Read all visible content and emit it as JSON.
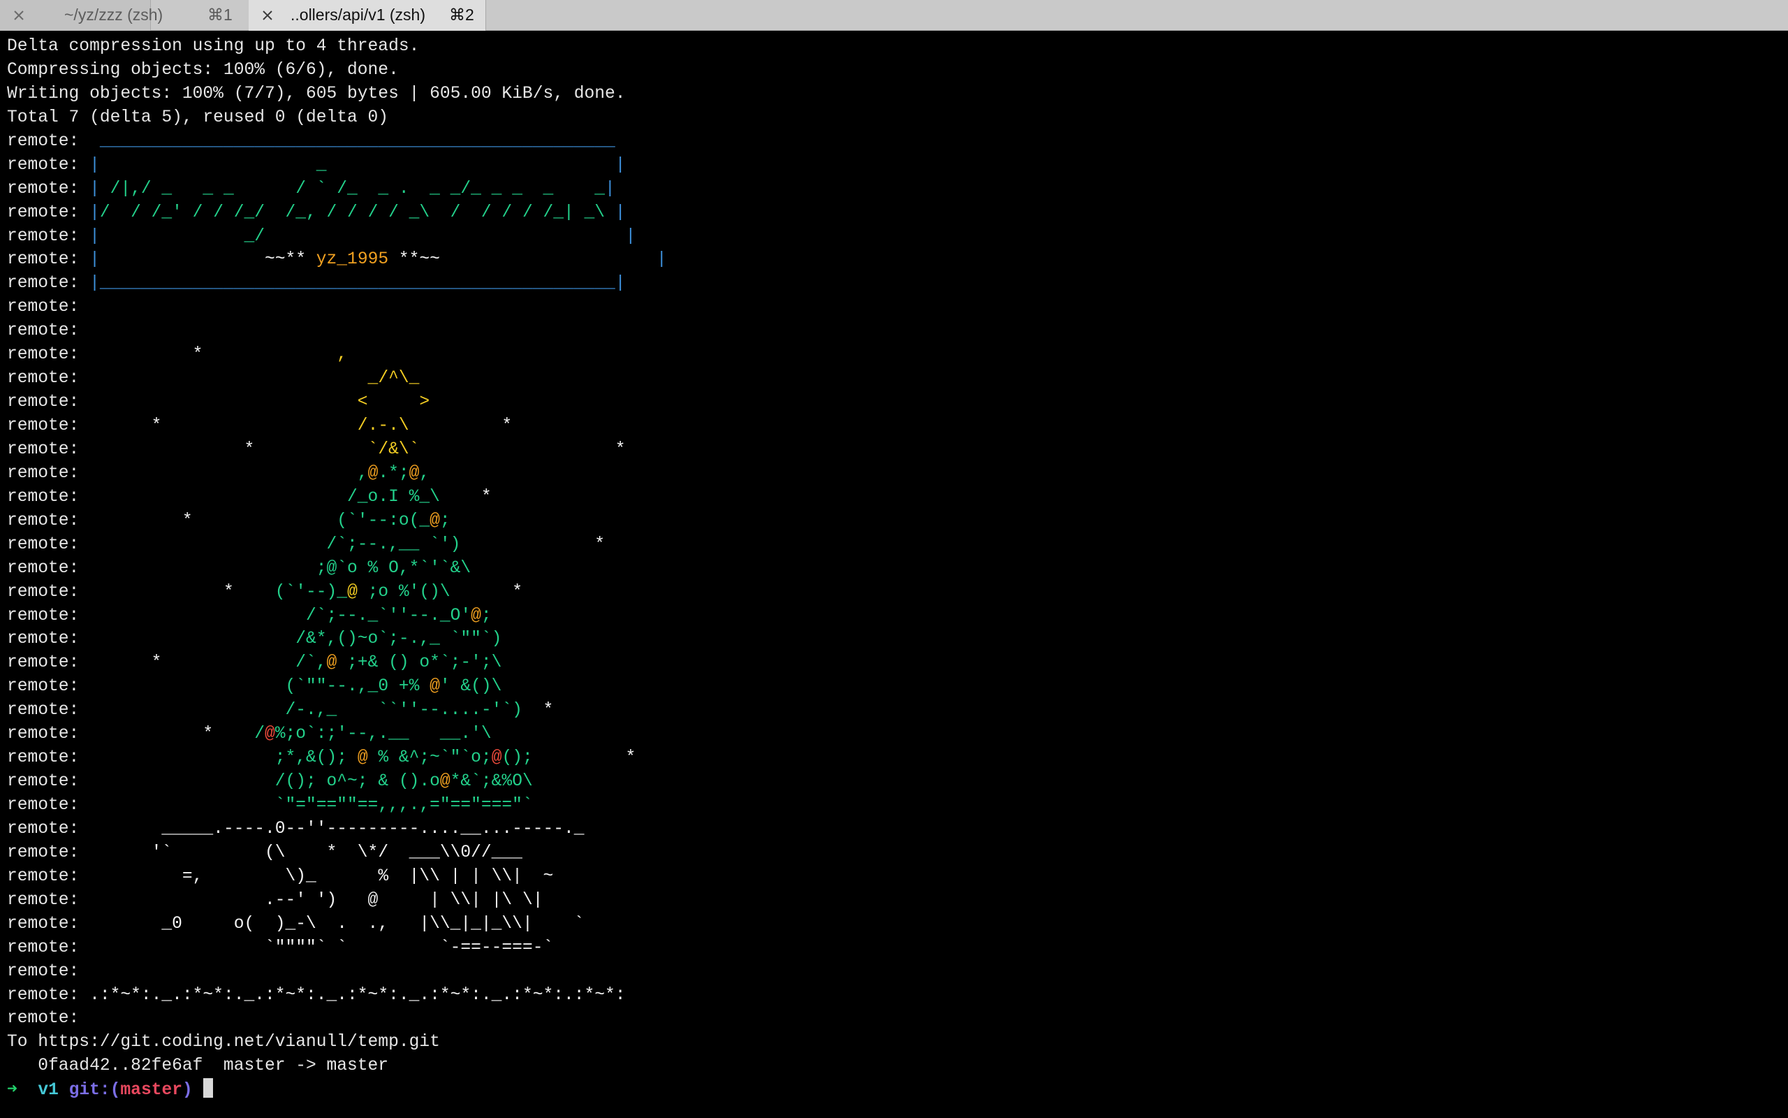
{
  "palette": {
    "default": "#e6e6e6",
    "blue": "#3d8fd9",
    "green": "#23d18b",
    "yellow": "#f3cd23",
    "orange": "#f0a020",
    "red": "#ef4b3c",
    "white": "#f2f2f2",
    "prompt_arrow": "#22d16b",
    "prompt_dir": "#45c8d6",
    "prompt_git": "#7b6ee6",
    "prompt_branch": "#e8485e"
  },
  "tabs": [
    {
      "title": "~/yz/zzz (zsh)",
      "shortcut": "⌘1",
      "close_icon": "close-icon",
      "active": false
    },
    {
      "title": "..ollers/api/v1 (zsh)",
      "shortcut": "⌘2",
      "close_icon": "close-icon",
      "active": true
    }
  ],
  "terminal": {
    "lines": [
      [
        [
          "Delta compression using up to 4 threads."
        ]
      ],
      [
        [
          "Compressing objects: 100% (6/6), done."
        ]
      ],
      [
        [
          "Writing objects: 100% (7/7), 605 bytes | 605.00 KiB/s, done."
        ]
      ],
      [
        [
          "Total 7 (delta 5), reused 0 (delta 0)"
        ]
      ],
      [
        [
          "remote: "
        ],
        [
          " __________________________________________________",
          "blue"
        ]
      ],
      [
        [
          "remote: "
        ],
        [
          "|",
          "blue"
        ],
        [
          "                     _                            ",
          "green"
        ],
        [
          "|",
          "blue"
        ]
      ],
      [
        [
          "remote: "
        ],
        [
          "|",
          "blue"
        ],
        [
          " /|,/ _   _ _      / ` /_  _ .  _ _/_ _ _  _    _",
          "green"
        ],
        [
          "|",
          "blue"
        ]
      ],
      [
        [
          "remote: "
        ],
        [
          "|",
          "blue"
        ],
        [
          "/  / /_' / / /_/  /_, / / / / _\\  /  / / / /_| _\\ ",
          "green"
        ],
        [
          "|",
          "blue"
        ]
      ],
      [
        [
          "remote: "
        ],
        [
          "|",
          "blue"
        ],
        [
          "              _/                                   ",
          "green"
        ],
        [
          "|",
          "blue"
        ]
      ],
      [
        [
          "remote: "
        ],
        [
          "|",
          "blue"
        ],
        [
          "                ~~** ",
          "white"
        ],
        [
          "yz_1995",
          "orange"
        ],
        [
          " **~~                     ",
          "white"
        ],
        [
          "|",
          "blue"
        ]
      ],
      [
        [
          "remote: "
        ],
        [
          "|__________________________________________________|",
          "blue"
        ]
      ],
      [
        [
          "remote: "
        ]
      ],
      [
        [
          "remote: "
        ]
      ],
      [
        [
          "remote: "
        ],
        [
          "          *",
          "white"
        ],
        [
          "             ,",
          "yellow"
        ]
      ],
      [
        [
          "remote: "
        ],
        [
          "                           _/^\\_",
          "yellow"
        ]
      ],
      [
        [
          "remote: "
        ],
        [
          "                          <     >",
          "yellow"
        ]
      ],
      [
        [
          "remote: "
        ],
        [
          "      *",
          "white"
        ],
        [
          "                   /.-.\\",
          "yellow"
        ],
        [
          "         *",
          "white"
        ]
      ],
      [
        [
          "remote: "
        ],
        [
          "               *",
          "white"
        ],
        [
          "           `/&\\`",
          "yellow"
        ],
        [
          "                   *",
          "white"
        ]
      ],
      [
        [
          "remote: "
        ],
        [
          "                          ,",
          "green"
        ],
        [
          "@",
          "orange"
        ],
        [
          ".*;",
          "green"
        ],
        [
          "@",
          "orange"
        ],
        [
          ",",
          "green"
        ]
      ],
      [
        [
          "remote: "
        ],
        [
          "                         /_o.I %_\\",
          "green"
        ],
        [
          "    *",
          "white"
        ]
      ],
      [
        [
          "remote: "
        ],
        [
          "         *",
          "white"
        ],
        [
          "              (`'--:o(_",
          "green"
        ],
        [
          "@",
          "orange"
        ],
        [
          ";",
          "green"
        ]
      ],
      [
        [
          "remote: "
        ],
        [
          "                       /`;--.,__ `')",
          "green"
        ],
        [
          "             *",
          "white"
        ]
      ],
      [
        [
          "remote: "
        ],
        [
          "                      ;@`o % O,*`'`&\\",
          "green"
        ]
      ],
      [
        [
          "remote: "
        ],
        [
          "             *",
          "white"
        ],
        [
          "    (`'--)_",
          "green"
        ],
        [
          "@",
          "yellow"
        ],
        [
          " ;o %'()\\",
          "green"
        ],
        [
          "      *",
          "white"
        ]
      ],
      [
        [
          "remote: "
        ],
        [
          "                     /`;--._`''--._O'",
          "green"
        ],
        [
          "@",
          "orange"
        ],
        [
          ";",
          "green"
        ]
      ],
      [
        [
          "remote: "
        ],
        [
          "                    /&*,()~o`;-.,_ `\"\"`)",
          "green"
        ]
      ],
      [
        [
          "remote: "
        ],
        [
          "      *",
          "white"
        ],
        [
          "             /`,",
          "green"
        ],
        [
          "@",
          "orange"
        ],
        [
          " ;+& () o*`;-';\\",
          "green"
        ]
      ],
      [
        [
          "remote: "
        ],
        [
          "                   (`\"\"--.,_0 +% ",
          "green"
        ],
        [
          "@",
          "orange"
        ],
        [
          "' &()\\",
          "green"
        ]
      ],
      [
        [
          "remote: "
        ],
        [
          "                   /-.,_    ``''--....-'`)",
          "green"
        ],
        [
          "  *",
          "white"
        ]
      ],
      [
        [
          "remote: "
        ],
        [
          "           *",
          "white"
        ],
        [
          "    /",
          "green"
        ],
        [
          "@",
          "red"
        ],
        [
          "%;o`:;'--,.__   __.'\\",
          "green"
        ]
      ],
      [
        [
          "remote: "
        ],
        [
          "                  ;*,&(); ",
          "green"
        ],
        [
          "@",
          "orange"
        ],
        [
          " % &^;~`\"`o;",
          "green"
        ],
        [
          "@",
          "red"
        ],
        [
          "();",
          "green"
        ],
        [
          "         *",
          "white"
        ]
      ],
      [
        [
          "remote: "
        ],
        [
          "                  /(); o^~; & ().o",
          "green"
        ],
        [
          "@",
          "orange"
        ],
        [
          "*&`;&%O\\",
          "green"
        ]
      ],
      [
        [
          "remote: "
        ],
        [
          "                  `\"=\"==\"\"==,,,.,=\"==\"===\"`",
          "green"
        ]
      ],
      [
        [
          "remote: "
        ],
        [
          "       _____.----.0--''---------....__...-----._",
          "white"
        ]
      ],
      [
        [
          "remote: "
        ],
        [
          "      '`         (\\    *  \\*/  ___\\\\0//___",
          "white"
        ]
      ],
      [
        [
          "remote: "
        ],
        [
          "         =,        \\)_      %  |\\\\ | | \\\\|  ~",
          "white"
        ]
      ],
      [
        [
          "remote: "
        ],
        [
          "                 .--' ')   @     | \\\\| |\\ \\|",
          "white"
        ]
      ],
      [
        [
          "remote: "
        ],
        [
          "       _0     o(  )_-\\  .  .,   |\\\\_|_|_\\\\|    `",
          "white"
        ]
      ],
      [
        [
          "remote: "
        ],
        [
          "                 `\"\"\"\"` `         `-==--===-`",
          "white"
        ]
      ],
      [
        [
          "remote: "
        ]
      ],
      [
        [
          "remote: "
        ],
        [
          ".:*~*:._.:*~*:._.:*~*:._.:*~*:._.:*~*:._.:*~*:.:*~*:",
          "white"
        ]
      ],
      [
        [
          "remote: "
        ]
      ],
      [
        [
          "To https://git.coding.net/vianull/temp.git"
        ]
      ],
      [
        [
          "   0faad42..82fe6af  master -> master"
        ]
      ],
      [
        [
          "➜ ",
          "prompt_arrow"
        ],
        [
          " v1 ",
          "prompt_dir"
        ],
        [
          "git:(",
          "prompt_git"
        ],
        [
          "master",
          "prompt_branch"
        ],
        [
          ")",
          "prompt_git"
        ],
        [
          " "
        ]
      ]
    ],
    "cursor_line": 44
  }
}
